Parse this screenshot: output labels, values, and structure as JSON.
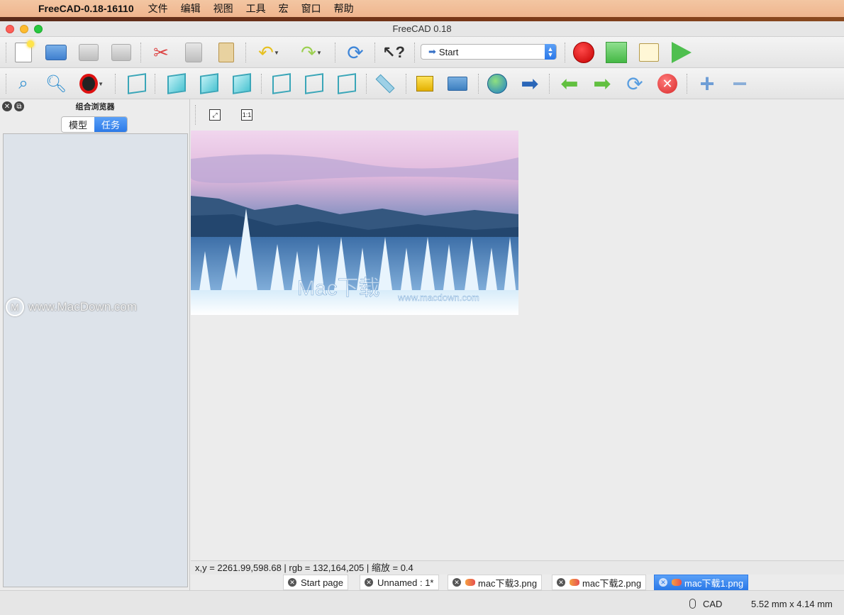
{
  "menubar": {
    "app_name": "FreeCAD-0.18-16110",
    "items": [
      "文件",
      "编辑",
      "视图",
      "工具",
      "宏",
      "窗口",
      "帮助"
    ]
  },
  "window": {
    "title": "FreeCAD 0.18"
  },
  "toolbar": {
    "workbench_selector": "Start"
  },
  "panel": {
    "title": "组合浏览器",
    "tabs": [
      {
        "label": "模型",
        "active": false
      },
      {
        "label": "任务",
        "active": true
      }
    ],
    "watermark": "www.MacDown.com"
  },
  "view": {
    "fit_label": "1:1",
    "image_watermark": "Mac下载",
    "image_watermark_url": "www.macdown.com"
  },
  "statusline": {
    "text": "x,y = 2261.99,598.68  |  rgb = 132,164,205  |  缩放 = 0.4"
  },
  "doc_tabs": [
    {
      "label": "Start page",
      "active": false,
      "image": false
    },
    {
      "label": "Unnamed : 1*",
      "active": false,
      "image": false
    },
    {
      "label": "mac下载3.png",
      "active": false,
      "image": true
    },
    {
      "label": "mac下载2.png",
      "active": false,
      "image": true
    },
    {
      "label": "mac下载1.png",
      "active": true,
      "image": true
    }
  ],
  "bottom_status": {
    "nav_style": "CAD",
    "dimensions": "5.52 mm x 4.14 mm"
  }
}
